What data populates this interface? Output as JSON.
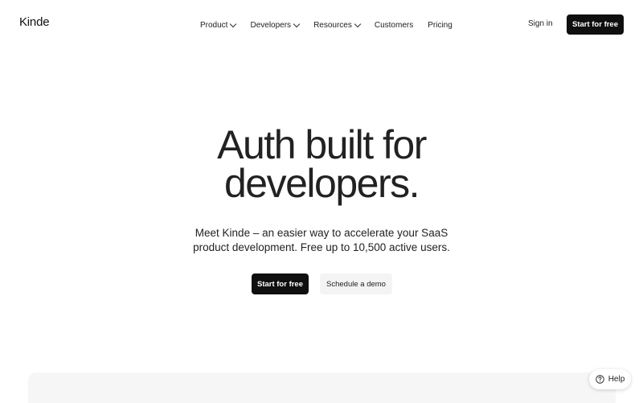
{
  "header": {
    "logo": "Kinde",
    "nav": [
      {
        "label": "Product",
        "has_dropdown": true
      },
      {
        "label": "Developers",
        "has_dropdown": true
      },
      {
        "label": "Resources",
        "has_dropdown": true
      },
      {
        "label": "Customers",
        "has_dropdown": false
      },
      {
        "label": "Pricing",
        "has_dropdown": false
      }
    ],
    "sign_in": "Sign in",
    "cta": "Start for free"
  },
  "hero": {
    "title_line1": "Auth built for",
    "title_line2": "developers.",
    "subtitle_line1": "Meet Kinde – an easier way to accelerate your SaaS",
    "subtitle_line2": "product development. Free up to 10,500 active users.",
    "primary_button": "Start for free",
    "secondary_button": "Schedule a demo"
  },
  "help_widget": {
    "label": "Help",
    "icon": "question-circle-icon"
  },
  "colors": {
    "background": "#ffffff",
    "primary_button_bg": "#0f0f0f",
    "primary_button_text": "#ffffff",
    "secondary_button_bg": "#f4f4f4",
    "panel_bg": "#f6f6f6",
    "text": "#222222"
  }
}
